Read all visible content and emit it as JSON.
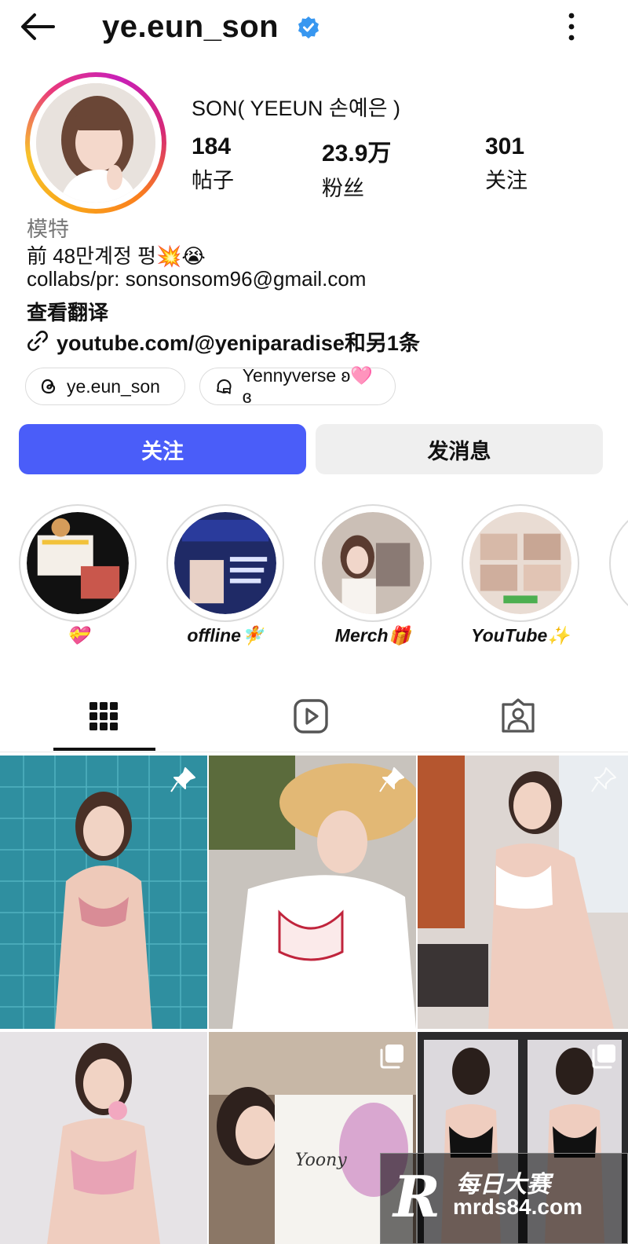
{
  "header": {
    "username": "ye.eun_son",
    "back_icon": "arrow-left-icon",
    "more_icon": "more-vertical-icon"
  },
  "profile": {
    "display_name": "SON( YEEUN 손예은 )",
    "stats": [
      {
        "num": "184",
        "label": "帖子"
      },
      {
        "num": "23.9万",
        "label": "粉丝"
      },
      {
        "num": "301",
        "label": "关注"
      }
    ],
    "category": "模特",
    "bio_line1": "前 48만계정 펑💥😭",
    "bio_line2": "collabs/pr: sonsonsom96@gmail.com",
    "translate": "查看翻译",
    "link": "youtube.com/@yeniparadise和另1条",
    "chips": [
      {
        "label": "ye.eun_son",
        "icon": "threads-icon"
      },
      {
        "label": "Yennyverse ʚ🩷ɞ",
        "icon": "chat-icon"
      }
    ]
  },
  "actions": {
    "follow": "关注",
    "message": "发消息"
  },
  "highlights": [
    {
      "label": "💝"
    },
    {
      "label": "offline🧚"
    },
    {
      "label": "Merch🎁"
    },
    {
      "label": "YouTube✨"
    }
  ],
  "tabs": [
    "grid-icon",
    "reels-icon",
    "tagged-icon"
  ],
  "watermark": {
    "letter": "R",
    "line1": "每日大赛",
    "line2": "mrds84.com"
  },
  "colors": {
    "follow_button": "#4a5df9",
    "verified": "#3897f0"
  }
}
